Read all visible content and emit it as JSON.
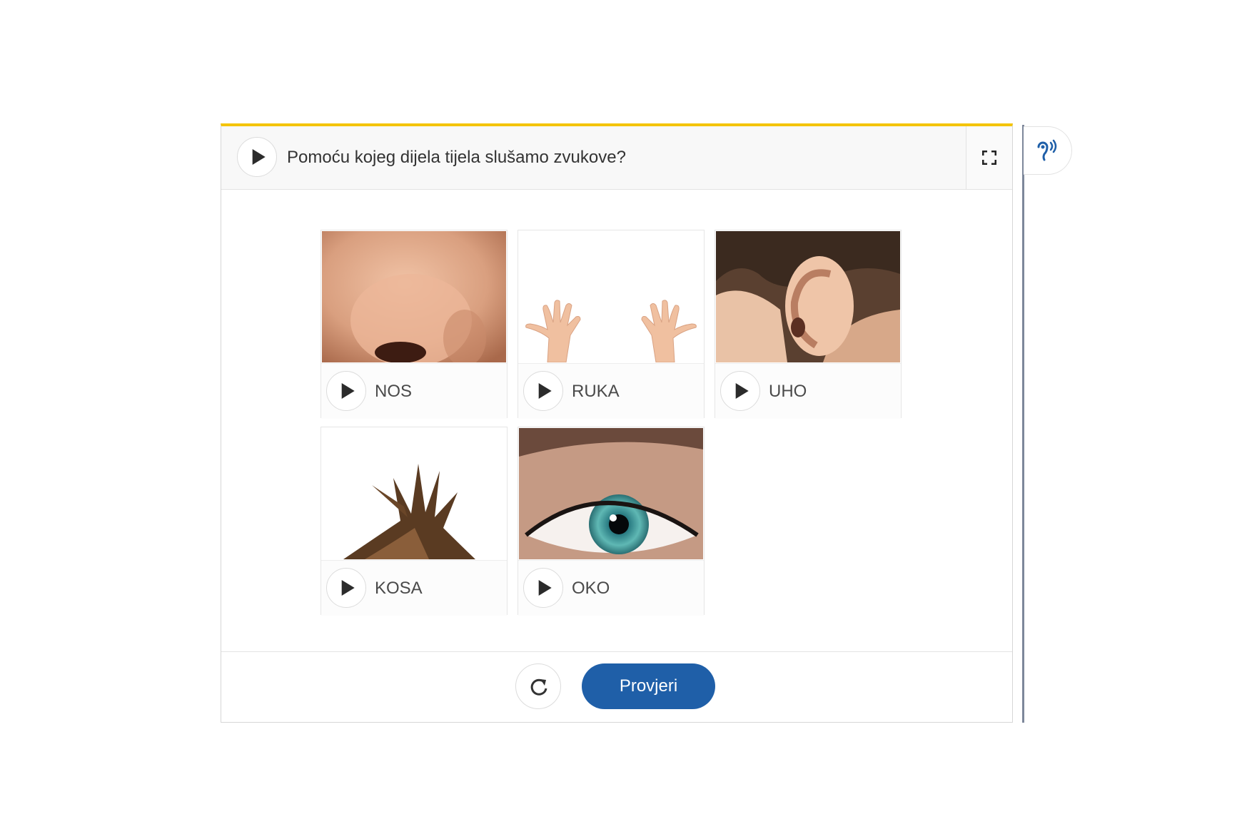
{
  "question": {
    "text": "Pomoću kojeg dijela tijela slušamo zvukove?",
    "play_icon": "play-icon"
  },
  "toolbar": {
    "fullscreen_icon": "fullscreen-icon",
    "accessibility_icon": "hearing-icon"
  },
  "options": [
    {
      "label": "NOS",
      "image": "nose-image"
    },
    {
      "label": "RUKA",
      "image": "hands-image"
    },
    {
      "label": "UHO",
      "image": "ear-image"
    },
    {
      "label": "KOSA",
      "image": "hair-image"
    },
    {
      "label": "OKO",
      "image": "eye-image"
    }
  ],
  "footer": {
    "reset_icon": "reset-icon",
    "check_label": "Provjeri"
  },
  "colors": {
    "accent_top_border": "#f4c400",
    "primary_button": "#1f5fa8"
  }
}
